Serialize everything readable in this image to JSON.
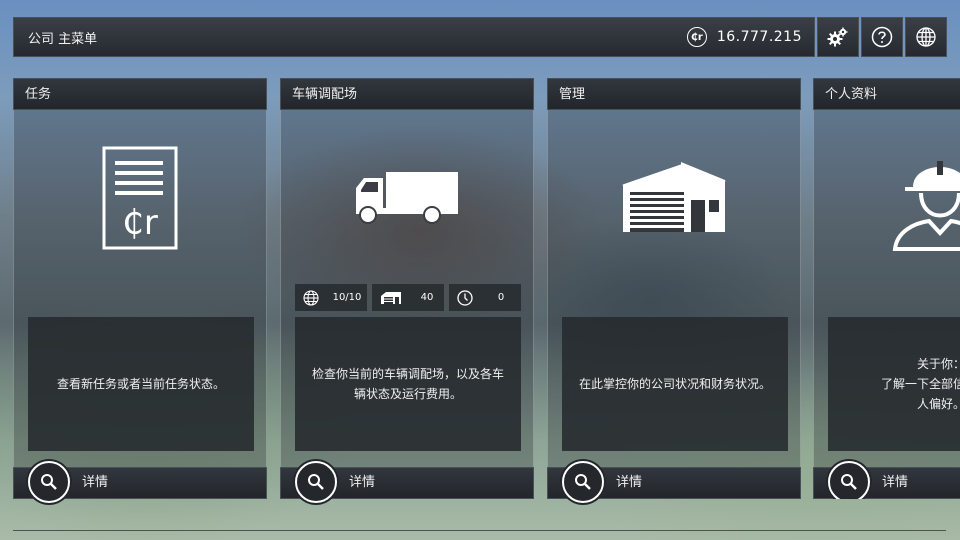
{
  "topbar": {
    "title": "公司 主菜单",
    "credits_symbol": "₵r",
    "credits": "16.777.215",
    "buttons": [
      "gear-icon",
      "help-icon",
      "globe-icon"
    ]
  },
  "cards": [
    {
      "title": "任务",
      "icon": "contract-icon",
      "icon_text": "₵r",
      "description": "查看新任务或者当前任务状态。",
      "details": "详情"
    },
    {
      "title": "车辆调配场",
      "icon": "truck-icon",
      "stats": [
        {
          "icon": "globe-icon",
          "value": "10/10"
        },
        {
          "icon": "garage-icon",
          "value": "40"
        },
        {
          "icon": "clock-icon",
          "value": "0"
        }
      ],
      "description": "检查你当前的车辆调配场，以及各车辆状态及运行费用。",
      "details": "详情"
    },
    {
      "title": "管理",
      "icon": "warehouse-icon",
      "description": "在此掌控你的公司状况和财务状况。",
      "details": "详情"
    },
    {
      "title": "个人资料",
      "icon": "worker-icon",
      "description": "关于你：\n了解一下全部信息、成\n人偏好。",
      "details": "详情"
    }
  ]
}
